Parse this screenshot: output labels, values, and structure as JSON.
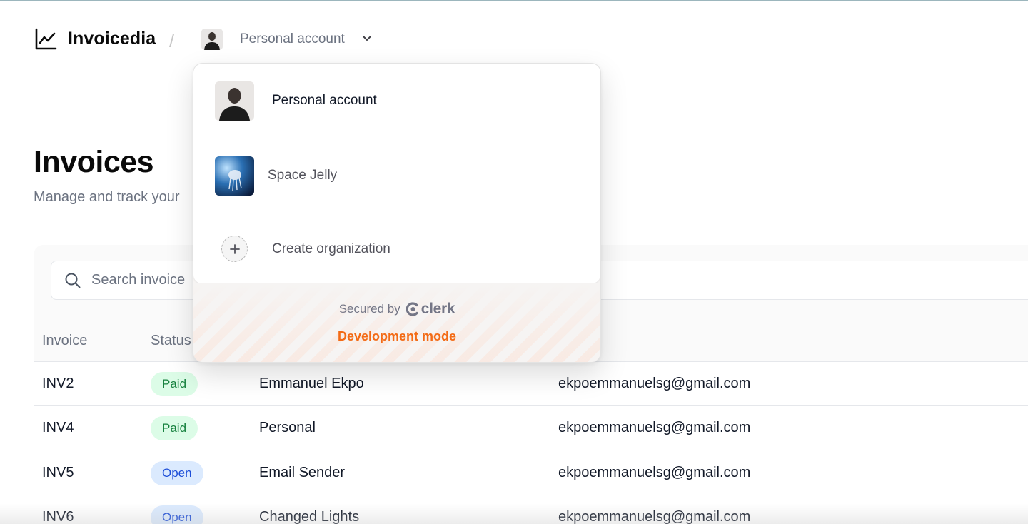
{
  "header": {
    "app_name": "Invoicedia",
    "separator": "/",
    "account_label": "Personal account"
  },
  "page": {
    "title": "Invoices",
    "subtitle": "Manage and track your"
  },
  "search": {
    "placeholder": "Search invoice"
  },
  "table": {
    "columns": [
      "Invoice",
      "Status"
    ],
    "rows": [
      {
        "invoice": "INV2",
        "status": "Paid",
        "customer": "Emmanuel Ekpo",
        "email": "ekpoemmanuelsg@gmail.com"
      },
      {
        "invoice": "INV4",
        "status": "Paid",
        "customer": "Personal",
        "email": "ekpoemmanuelsg@gmail.com"
      },
      {
        "invoice": "INV5",
        "status": "Open",
        "customer": "Email Sender",
        "email": "ekpoemmanuelsg@gmail.com"
      },
      {
        "invoice": "INV6",
        "status": "Open",
        "customer": "Changed Lights",
        "email": "ekpoemmanuelsg@gmail.com"
      }
    ]
  },
  "dropdown": {
    "items": [
      {
        "label": "Personal account"
      },
      {
        "label": "Space Jelly"
      },
      {
        "label": "Create organization"
      }
    ],
    "footer": {
      "secured_by": "Secured by",
      "brand": "clerk",
      "mode": "Development mode"
    }
  },
  "colors": {
    "paid_bg": "#dcfce7",
    "paid_fg": "#15803d",
    "open_bg": "#dbeafe",
    "open_fg": "#1d4ed8",
    "dev_mode": "#f36b16"
  },
  "icons": [
    "chart-line-icon",
    "chevron-down-icon",
    "search-icon",
    "plus-icon",
    "clerk-logo-icon"
  ]
}
